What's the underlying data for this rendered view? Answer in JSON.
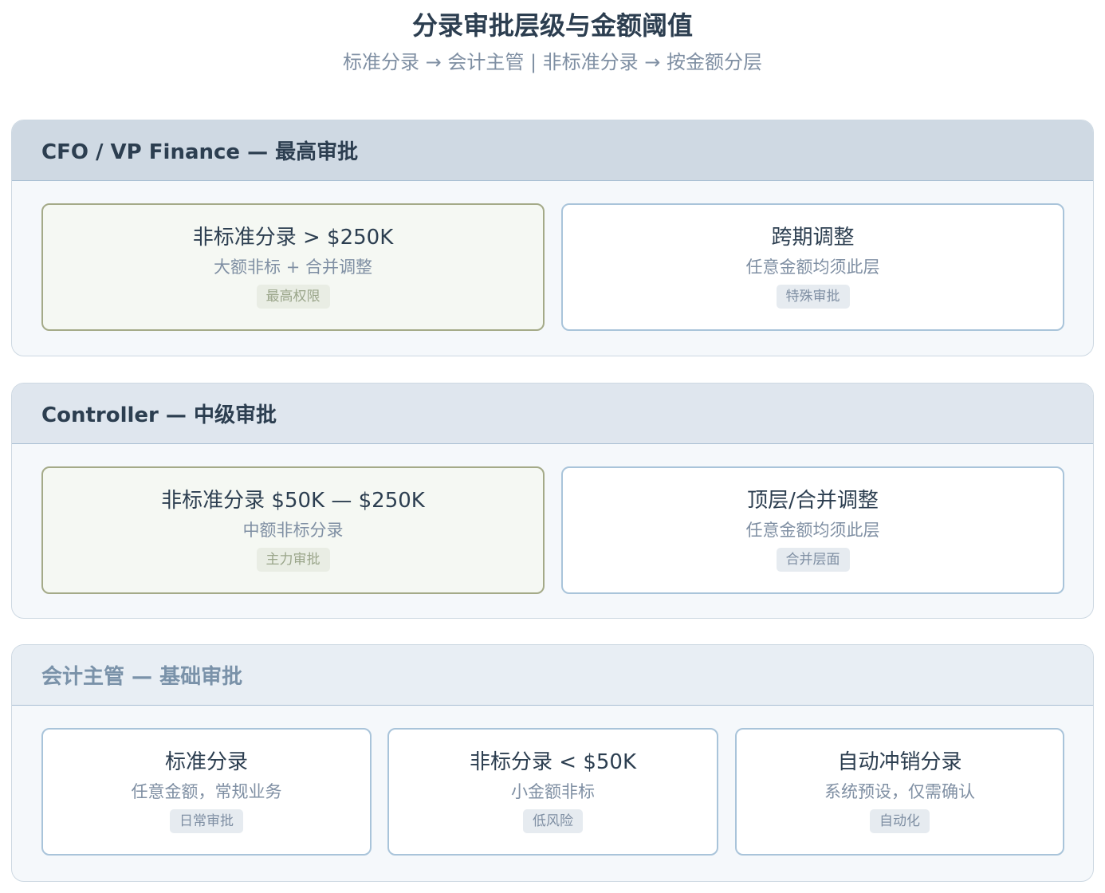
{
  "title": "分录审批层级与金额阈值",
  "subtitle": "标准分录 → 会计主管 | 非标准分录 → 按金额分层",
  "tiers": [
    {
      "header": "CFO / VP Finance — 最高审批",
      "cards": [
        {
          "title": "非标准分录 > $250K",
          "desc": "大额非标 + 合并调整",
          "badge": "最高权限"
        },
        {
          "title": "跨期调整",
          "desc": "任意金额均须此层",
          "badge": "特殊审批"
        }
      ]
    },
    {
      "header": "Controller — 中级审批",
      "cards": [
        {
          "title": "非标准分录 $50K — $250K",
          "desc": "中额非标分录",
          "badge": "主力审批"
        },
        {
          "title": "顶层/合并调整",
          "desc": "任意金额均须此层",
          "badge": "合并层面"
        }
      ]
    },
    {
      "header": "会计主管 — 基础审批",
      "cards": [
        {
          "title": "标准分录",
          "desc": "任意金额，常规业务",
          "badge": "日常审批"
        },
        {
          "title": "非标分录 < $50K",
          "desc": "小金额非标",
          "badge": "低风险"
        },
        {
          "title": "自动冲销分录",
          "desc": "系统预设，仅需确认",
          "badge": "自动化"
        }
      ]
    }
  ]
}
